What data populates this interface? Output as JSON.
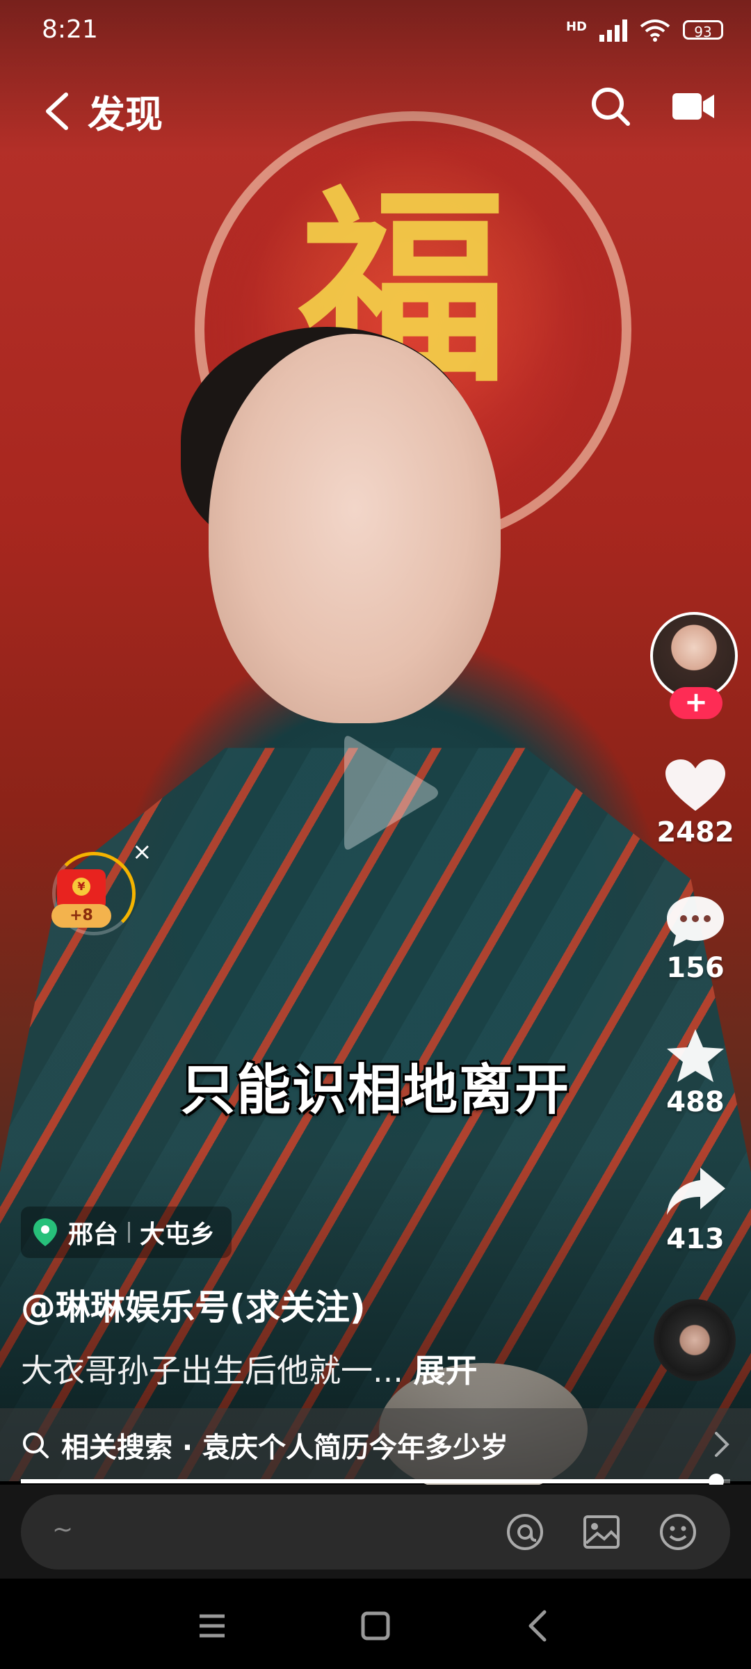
{
  "status_bar": {
    "time": "8:21",
    "network": "HD",
    "battery": "93"
  },
  "top_nav": {
    "title": "发现"
  },
  "subtitle": "只能识相地离开",
  "actions": {
    "likes": "2482",
    "comments": "156",
    "favorites": "488",
    "shares": "413"
  },
  "follow_label": "+",
  "red_packet": {
    "label": "+8",
    "coin": "¥",
    "close": "×"
  },
  "location": {
    "city": "邢台",
    "area": "大屯乡"
  },
  "author": "@琳琳娱乐号(求关注)",
  "description": {
    "text": "大衣哥孙子出生后他就一... ",
    "expand": "展开"
  },
  "related_search": {
    "label": "相关搜索",
    "separator": " · ",
    "query": "袁庆个人简历今年多少岁"
  },
  "progress": {
    "played_fraction": 0.98
  },
  "comment_input": {
    "placeholder": "~"
  },
  "colors": {
    "accent": "#fe2c55",
    "background": "#000000"
  }
}
